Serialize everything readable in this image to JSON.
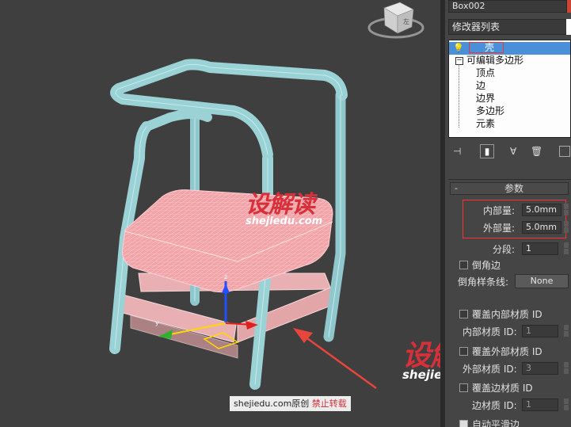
{
  "object_name": "Box002",
  "modifier_list_label": "修改器列表",
  "modifier_stack": {
    "items": [
      {
        "label": "壳",
        "selected": true
      },
      {
        "label": "可编辑多边形",
        "selected": false
      },
      {
        "label": "顶点",
        "selected": false
      },
      {
        "label": "边",
        "selected": false
      },
      {
        "label": "边界",
        "selected": false
      },
      {
        "label": "多边形",
        "selected": false
      },
      {
        "label": "元素",
        "selected": false
      }
    ]
  },
  "stack_toolbar": {
    "pin_icon": "pin-stack-icon",
    "show_end_icon": "show-end-result-icon",
    "make_unique_icon": "make-unique-icon",
    "remove_icon": "remove-modifier-icon",
    "configure_icon": "configure-modifier-sets-icon"
  },
  "rollout": {
    "toggle": "-",
    "title": "参数",
    "inner_amount_label": "内部量:",
    "inner_amount_value": "5.0mm",
    "outer_amount_label": "外部量:",
    "outer_amount_value": "5.0mm",
    "segments_label": "分段:",
    "segments_value": "1",
    "bevel_edges_label": "倒角边",
    "bevel_spline_label": "倒角样条线:",
    "bevel_spline_value": "None",
    "override_inner_mat_label": "覆盖内部材质 ID",
    "inner_mat_id_label": "内部材质 ID:",
    "inner_mat_id_value": "1",
    "override_outer_mat_label": "覆盖外部材质 ID",
    "outer_mat_id_label": "外部材质 ID:",
    "outer_mat_id_value": "3",
    "override_edge_mat_label": "覆盖边材质 ID",
    "edge_mat_id_label": "边材质 ID:",
    "edge_mat_id_value": "1",
    "auto_smooth_label": "自动平滑边"
  },
  "viewcube_label": "左",
  "watermark": {
    "logo": "设解读",
    "url": "shejiedu.com"
  },
  "credit": {
    "site": "shejiedu.com原创",
    "notice": "禁止转载"
  },
  "colors": {
    "viewport_bg": "#3f3f3f",
    "frame": "#a9dde0",
    "cushion": "#f0a0a4",
    "highlight_box": "#ff3030",
    "selection_blue": "#3a8fd8",
    "watermark_red": "#d8303a"
  }
}
